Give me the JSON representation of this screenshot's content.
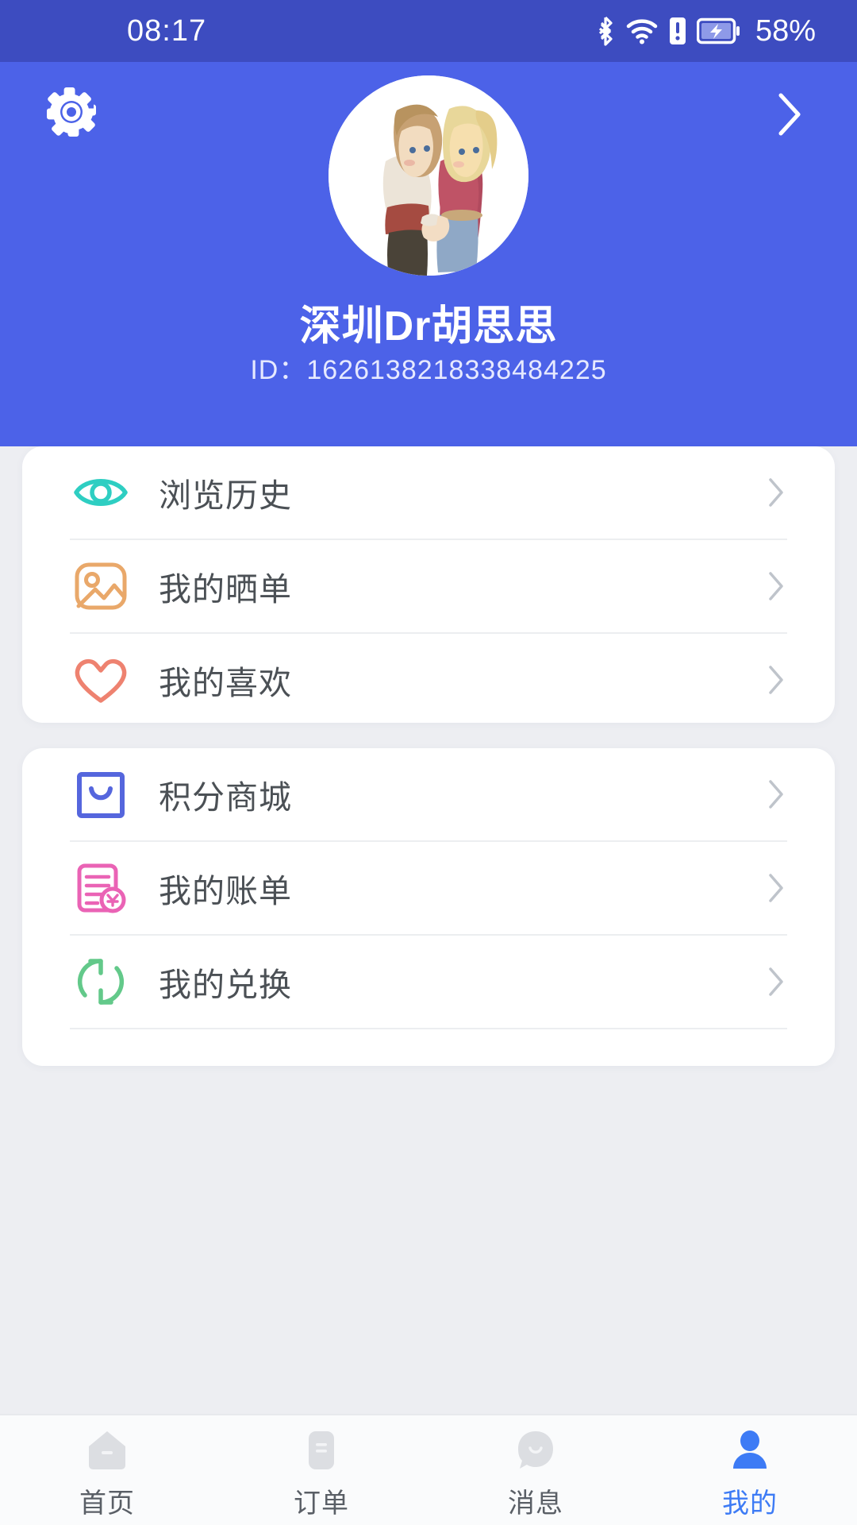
{
  "status_bar": {
    "time": "08:17",
    "battery_percent": "58%",
    "icons": [
      "bluetooth-icon",
      "wifi-icon",
      "sim-alert-icon",
      "battery-charging-icon"
    ]
  },
  "header": {
    "settings_icon": "gear-icon",
    "forward_icon": "chevron-right-icon",
    "avatar": "user-avatar",
    "username": "深圳Dr胡思思",
    "id_label": "ID：",
    "id_value": "1626138218338484225",
    "background_color": "#4c62e8"
  },
  "menu_cards": [
    {
      "rows": [
        {
          "label": "浏览历史",
          "icon": "eye-icon",
          "icon_color": "#2ecec2"
        },
        {
          "label": "我的晒单",
          "icon": "image-icon",
          "icon_color": "#e9a86a"
        },
        {
          "label": "我的喜欢",
          "icon": "heart-icon",
          "icon_color": "#ee8270"
        }
      ]
    },
    {
      "rows": [
        {
          "label": "积分商城",
          "icon": "shopping-bag-icon",
          "icon_color": "#5566dd"
        },
        {
          "label": "我的账单",
          "icon": "bill-yuan-icon",
          "icon_color": "#ea63b5"
        },
        {
          "label": "我的兑换",
          "icon": "exchange-refresh-icon",
          "icon_color": "#63c98a"
        }
      ]
    }
  ],
  "tab_bar": {
    "active_color": "#3d7bf5",
    "inactive_color": "#dcdee2",
    "items": [
      {
        "label": "首页",
        "icon": "home-icon",
        "active": false
      },
      {
        "label": "订单",
        "icon": "order-list-icon",
        "active": false
      },
      {
        "label": "消息",
        "icon": "message-icon",
        "active": false
      },
      {
        "label": "我的",
        "icon": "person-icon",
        "active": true
      }
    ]
  }
}
